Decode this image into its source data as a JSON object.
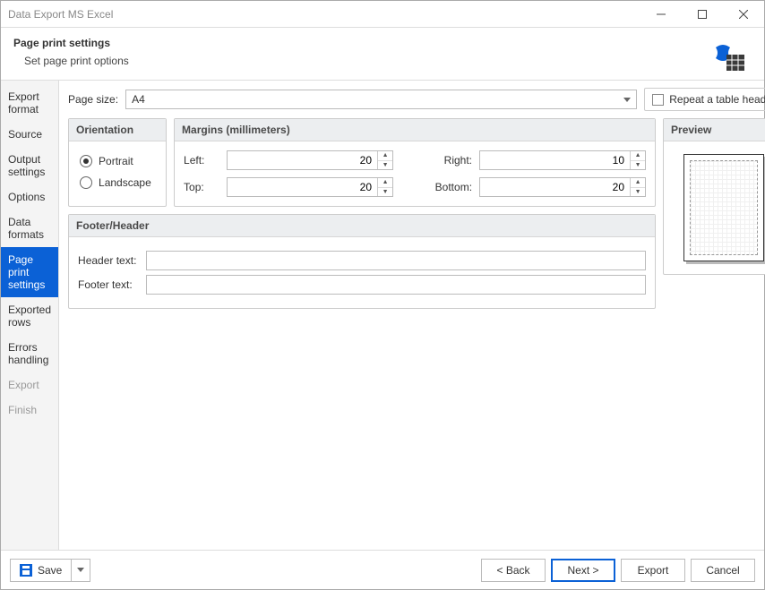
{
  "window": {
    "title": "Data Export MS Excel"
  },
  "header": {
    "title": "Page print settings",
    "subtitle": "Set page print options"
  },
  "nav": {
    "items": [
      {
        "label": "Export format"
      },
      {
        "label": "Source"
      },
      {
        "label": "Output settings"
      },
      {
        "label": "Options"
      },
      {
        "label": "Data formats"
      },
      {
        "label": "Page print settings",
        "selected": true
      },
      {
        "label": "Exported rows"
      },
      {
        "label": "Errors handling"
      },
      {
        "label": "Export",
        "disabled": true
      },
      {
        "label": "Finish",
        "disabled": true
      }
    ]
  },
  "page": {
    "page_size_label": "Page size:",
    "page_size_value": "A4",
    "repeat_header_label": "Repeat a table header",
    "orientation": {
      "legend": "Orientation",
      "portrait": "Portrait",
      "landscape": "Landscape",
      "value": "Portrait"
    },
    "margins": {
      "legend": "Margins (millimeters)",
      "left_label": "Left:",
      "left_value": "20",
      "top_label": "Top:",
      "top_value": "20",
      "right_label": "Right:",
      "right_value": "10",
      "bottom_label": "Bottom:",
      "bottom_value": "20"
    },
    "fh": {
      "legend": "Footer/Header",
      "header_label": "Header text:",
      "header_value": "",
      "footer_label": "Footer text:",
      "footer_value": ""
    },
    "preview": {
      "legend": "Preview"
    }
  },
  "footer": {
    "save": "Save",
    "back": "< Back",
    "next": "Next >",
    "export": "Export",
    "cancel": "Cancel"
  }
}
